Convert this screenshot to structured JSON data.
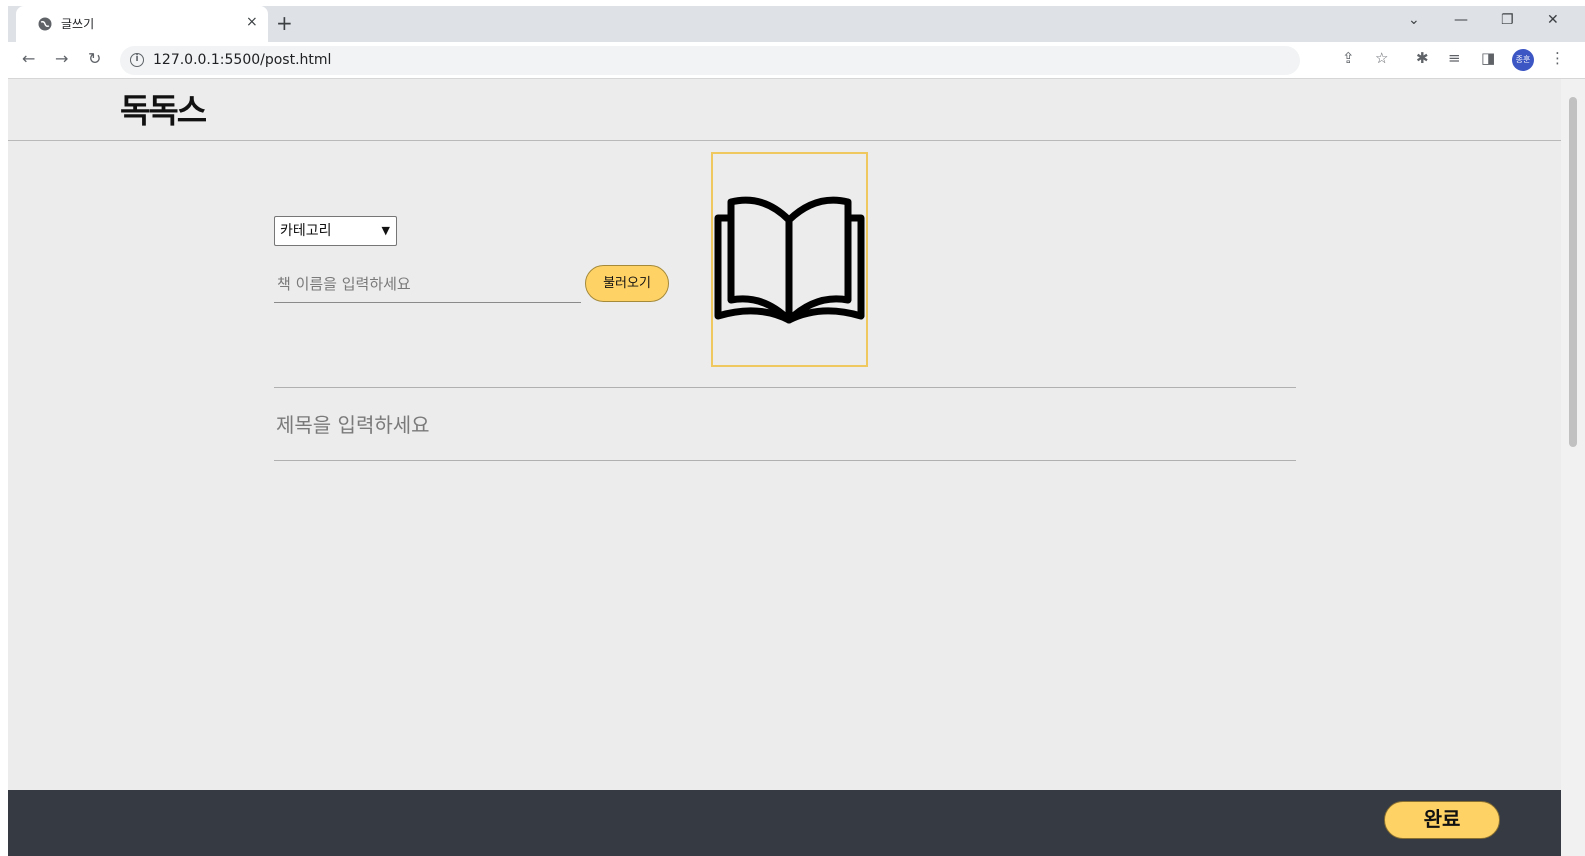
{
  "browser": {
    "tab_title": "글쓰기",
    "tab_close": "×",
    "new_tab": "+",
    "url": "127.0.0.1:5500/post.html",
    "avatar_initials": "종훈",
    "window_controls": {
      "minimize": "—",
      "restore": "❐",
      "close": "✕",
      "tab_search": "⌄"
    }
  },
  "site": {
    "logo": "독독스"
  },
  "form": {
    "category_select": "카테고리",
    "book_placeholder": "책 이름을 입력하세요",
    "load_button": "불러오기",
    "title_placeholder": "제목을 입력하세요"
  },
  "footer": {
    "done_button": "완료"
  },
  "colors": {
    "accent": "#ffd266",
    "footer_bg": "#363a43",
    "page_bg": "#ececec"
  }
}
